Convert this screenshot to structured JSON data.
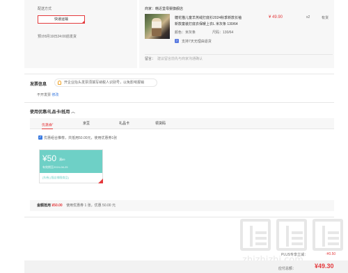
{
  "shipping": {
    "title": "配送方式",
    "method_button": "快递运输",
    "estimate": "预计8月19日24:00前发货"
  },
  "shop": {
    "seller_label": "商家：",
    "seller_name": "韩近堂母婴旗舰店",
    "product_name_line1": "糖花猫儿童羊羔绒打底衫2024秋季新款长袖",
    "product_name_line2": "新款童装打底衣保暖上衣L 米灰条 130/64",
    "color_label": "颜色：",
    "color_value": "米灰条",
    "size_label": "尺码：",
    "size_value": "130/64",
    "service_icon": "service-badge-icon",
    "service_icon_glyph": "7",
    "service_text": "支持7天无理由退货",
    "price": "¥ 49.90",
    "qty": "x2",
    "stock": "有货",
    "remark_label": "留言：",
    "remark_placeholder": "建议留言前先与商家沟通确认"
  },
  "invoice": {
    "title": "发票信息",
    "tip": "开企业抬头发票须填写纳税人识别号，以免影响报销",
    "status": "不开发票",
    "edit_link": "修改"
  },
  "coupons": {
    "title": "使用优惠/礼品卡/抵用",
    "tabs": [
      {
        "label": "优惠券",
        "badge": "•",
        "active": true
      },
      {
        "label": "京豆"
      },
      {
        "label": "礼品卡"
      },
      {
        "label": "领货码"
      }
    ],
    "checkbox_glyph": "✓",
    "combo_text": "优惠组合推荐，共抵用50.00元，使用优惠券1张",
    "card": {
      "amount": "¥50",
      "condition": "满89",
      "expiry": "有效期至2024-08-25",
      "tags": "[东券] [限店铺限商品]"
    }
  },
  "summary": {
    "label": "金额抵用",
    "amount": "¥50.00",
    "detail": "使用优惠券 1 张，优惠 50.00 元"
  },
  "totals": {
    "plus_label": "PLUS专享立减：",
    "plus_value": "-¥0.50",
    "final_label": "应付总额：",
    "final_value": "¥49.30"
  },
  "watermark": {
    "text": "zhizhizhi.com"
  },
  "colors": {
    "accent": "#e4393c",
    "coupon": "#6ed0c6",
    "link": "#3a7ae0"
  }
}
